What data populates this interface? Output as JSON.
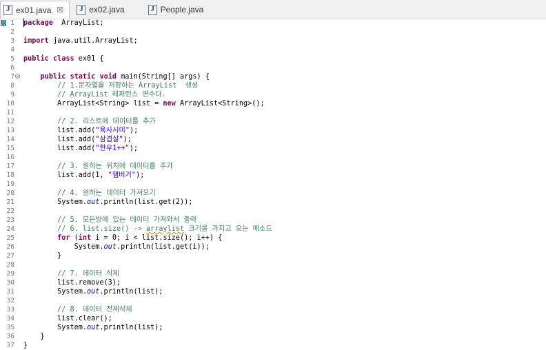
{
  "tabs": [
    {
      "label": "ex01.java",
      "active": true,
      "closable": true
    },
    {
      "label": "ex02.java",
      "active": false,
      "closable": false
    },
    {
      "label": "People.java",
      "active": false,
      "closable": false
    }
  ],
  "tab_close_glyph": "☒",
  "lines": [
    {
      "n": "1",
      "segs": [
        [
          "kw",
          "package"
        ],
        [
          "",
          "  ArrayList;"
        ]
      ]
    },
    {
      "n": "2",
      "segs": []
    },
    {
      "n": "3",
      "segs": [
        [
          "kw",
          "import"
        ],
        [
          "",
          " java.util.ArrayList;"
        ]
      ]
    },
    {
      "n": "4",
      "segs": []
    },
    {
      "n": "5",
      "segs": [
        [
          "kw",
          "public"
        ],
        [
          "",
          " "
        ],
        [
          "kw",
          "class"
        ],
        [
          "",
          " ex01 {"
        ]
      ]
    },
    {
      "n": "6",
      "segs": []
    },
    {
      "n": "7",
      "fold": true,
      "segs": [
        [
          "",
          "    "
        ],
        [
          "kw",
          "public"
        ],
        [
          "",
          " "
        ],
        [
          "kw",
          "static"
        ],
        [
          "",
          " "
        ],
        [
          "kw",
          "void"
        ],
        [
          "",
          " main(String[] args) {"
        ]
      ]
    },
    {
      "n": "8",
      "segs": [
        [
          "",
          "        "
        ],
        [
          "cm",
          "// 1.문자열을 저장하는 ArrayList  생성"
        ]
      ]
    },
    {
      "n": "9",
      "segs": [
        [
          "",
          "        "
        ],
        [
          "cm",
          "// ArrayList 레퍼런스 변수다."
        ]
      ]
    },
    {
      "n": "10",
      "segs": [
        [
          "",
          "        ArrayList<String> list = "
        ],
        [
          "kw",
          "new"
        ],
        [
          "",
          " ArrayList<String>();"
        ]
      ]
    },
    {
      "n": "11",
      "segs": []
    },
    {
      "n": "12",
      "segs": [
        [
          "",
          "        "
        ],
        [
          "cm",
          "// 2. 리스트에 데이터를 추가"
        ]
      ]
    },
    {
      "n": "13",
      "segs": [
        [
          "",
          "        list.add("
        ],
        [
          "st",
          "\"육사시미\""
        ],
        [
          "",
          ");"
        ]
      ]
    },
    {
      "n": "14",
      "segs": [
        [
          "",
          "        list.add("
        ],
        [
          "st",
          "\"삼겹살\""
        ],
        [
          "",
          ");"
        ]
      ]
    },
    {
      "n": "15",
      "segs": [
        [
          "",
          "        list.add("
        ],
        [
          "st",
          "\"한우1++\""
        ],
        [
          "",
          ");"
        ]
      ]
    },
    {
      "n": "16",
      "segs": []
    },
    {
      "n": "17",
      "segs": [
        [
          "",
          "        "
        ],
        [
          "cm",
          "// 3. 원하는 위치에 데이터를 추가"
        ]
      ]
    },
    {
      "n": "18",
      "segs": [
        [
          "",
          "        list.add(1, "
        ],
        [
          "st",
          "\"햄버거\""
        ],
        [
          "",
          ");"
        ]
      ]
    },
    {
      "n": "19",
      "segs": []
    },
    {
      "n": "20",
      "segs": [
        [
          "",
          "        "
        ],
        [
          "cm",
          "// 4. 원하는 데이터 가져오기"
        ]
      ]
    },
    {
      "n": "21",
      "segs": [
        [
          "",
          "        System."
        ],
        [
          "it",
          "out"
        ],
        [
          "",
          ".println(list.get(2));"
        ]
      ]
    },
    {
      "n": "22",
      "segs": []
    },
    {
      "n": "23",
      "segs": [
        [
          "",
          "        "
        ],
        [
          "cm",
          "// 5. 모든방에 있는 데이터 가져와서 출력"
        ]
      ]
    },
    {
      "n": "24",
      "segs": [
        [
          "",
          "        "
        ],
        [
          "cm",
          "// 6. list.size() -> "
        ],
        [
          "cm ul",
          "arraylist"
        ],
        [
          "cm",
          " 크기를 가지고 오는 메소드"
        ]
      ]
    },
    {
      "n": "25",
      "segs": [
        [
          "",
          "        "
        ],
        [
          "kw",
          "for"
        ],
        [
          "",
          " ("
        ],
        [
          "kw",
          "int"
        ],
        [
          "",
          " i = 0; i < list.size(); i++) {"
        ]
      ]
    },
    {
      "n": "26",
      "segs": [
        [
          "",
          "            System."
        ],
        [
          "it",
          "out"
        ],
        [
          "",
          ".println(list.get(i));"
        ]
      ]
    },
    {
      "n": "27",
      "segs": [
        [
          "",
          "        }"
        ]
      ]
    },
    {
      "n": "28",
      "segs": []
    },
    {
      "n": "29",
      "segs": [
        [
          "",
          "        "
        ],
        [
          "cm",
          "// 7. 데이터 삭제"
        ]
      ]
    },
    {
      "n": "30",
      "segs": [
        [
          "",
          "        list.remove(3);"
        ]
      ]
    },
    {
      "n": "31",
      "segs": [
        [
          "",
          "        System."
        ],
        [
          "it",
          "out"
        ],
        [
          "",
          ".println(list);"
        ]
      ]
    },
    {
      "n": "32",
      "segs": []
    },
    {
      "n": "33",
      "segs": [
        [
          "",
          "        "
        ],
        [
          "cm",
          "// 8. 데이터 전체삭제"
        ]
      ]
    },
    {
      "n": "34",
      "segs": [
        [
          "",
          "        list.clear();"
        ]
      ]
    },
    {
      "n": "35",
      "segs": [
        [
          "",
          "        System."
        ],
        [
          "it",
          "out"
        ],
        [
          "",
          ".println(list);"
        ]
      ]
    },
    {
      "n": "36",
      "segs": [
        [
          "",
          "    }"
        ]
      ]
    },
    {
      "n": "37",
      "segs": [
        [
          "",
          "}"
        ]
      ]
    }
  ]
}
